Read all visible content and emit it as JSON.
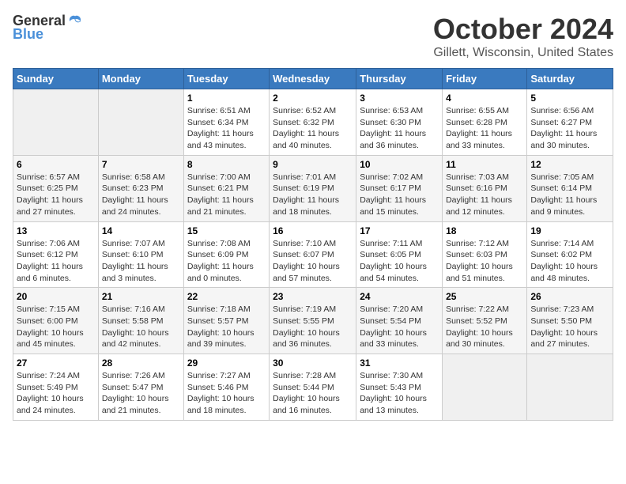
{
  "header": {
    "logo_general": "General",
    "logo_blue": "Blue",
    "title": "October 2024",
    "location": "Gillett, Wisconsin, United States"
  },
  "days_of_week": [
    "Sunday",
    "Monday",
    "Tuesday",
    "Wednesday",
    "Thursday",
    "Friday",
    "Saturday"
  ],
  "weeks": [
    [
      {
        "day": "",
        "empty": true
      },
      {
        "day": "",
        "empty": true
      },
      {
        "day": "1",
        "sunrise": "Sunrise: 6:51 AM",
        "sunset": "Sunset: 6:34 PM",
        "daylight": "Daylight: 11 hours and 43 minutes."
      },
      {
        "day": "2",
        "sunrise": "Sunrise: 6:52 AM",
        "sunset": "Sunset: 6:32 PM",
        "daylight": "Daylight: 11 hours and 40 minutes."
      },
      {
        "day": "3",
        "sunrise": "Sunrise: 6:53 AM",
        "sunset": "Sunset: 6:30 PM",
        "daylight": "Daylight: 11 hours and 36 minutes."
      },
      {
        "day": "4",
        "sunrise": "Sunrise: 6:55 AM",
        "sunset": "Sunset: 6:28 PM",
        "daylight": "Daylight: 11 hours and 33 minutes."
      },
      {
        "day": "5",
        "sunrise": "Sunrise: 6:56 AM",
        "sunset": "Sunset: 6:27 PM",
        "daylight": "Daylight: 11 hours and 30 minutes."
      }
    ],
    [
      {
        "day": "6",
        "sunrise": "Sunrise: 6:57 AM",
        "sunset": "Sunset: 6:25 PM",
        "daylight": "Daylight: 11 hours and 27 minutes."
      },
      {
        "day": "7",
        "sunrise": "Sunrise: 6:58 AM",
        "sunset": "Sunset: 6:23 PM",
        "daylight": "Daylight: 11 hours and 24 minutes."
      },
      {
        "day": "8",
        "sunrise": "Sunrise: 7:00 AM",
        "sunset": "Sunset: 6:21 PM",
        "daylight": "Daylight: 11 hours and 21 minutes."
      },
      {
        "day": "9",
        "sunrise": "Sunrise: 7:01 AM",
        "sunset": "Sunset: 6:19 PM",
        "daylight": "Daylight: 11 hours and 18 minutes."
      },
      {
        "day": "10",
        "sunrise": "Sunrise: 7:02 AM",
        "sunset": "Sunset: 6:17 PM",
        "daylight": "Daylight: 11 hours and 15 minutes."
      },
      {
        "day": "11",
        "sunrise": "Sunrise: 7:03 AM",
        "sunset": "Sunset: 6:16 PM",
        "daylight": "Daylight: 11 hours and 12 minutes."
      },
      {
        "day": "12",
        "sunrise": "Sunrise: 7:05 AM",
        "sunset": "Sunset: 6:14 PM",
        "daylight": "Daylight: 11 hours and 9 minutes."
      }
    ],
    [
      {
        "day": "13",
        "sunrise": "Sunrise: 7:06 AM",
        "sunset": "Sunset: 6:12 PM",
        "daylight": "Daylight: 11 hours and 6 minutes."
      },
      {
        "day": "14",
        "sunrise": "Sunrise: 7:07 AM",
        "sunset": "Sunset: 6:10 PM",
        "daylight": "Daylight: 11 hours and 3 minutes."
      },
      {
        "day": "15",
        "sunrise": "Sunrise: 7:08 AM",
        "sunset": "Sunset: 6:09 PM",
        "daylight": "Daylight: 11 hours and 0 minutes."
      },
      {
        "day": "16",
        "sunrise": "Sunrise: 7:10 AM",
        "sunset": "Sunset: 6:07 PM",
        "daylight": "Daylight: 10 hours and 57 minutes."
      },
      {
        "day": "17",
        "sunrise": "Sunrise: 7:11 AM",
        "sunset": "Sunset: 6:05 PM",
        "daylight": "Daylight: 10 hours and 54 minutes."
      },
      {
        "day": "18",
        "sunrise": "Sunrise: 7:12 AM",
        "sunset": "Sunset: 6:03 PM",
        "daylight": "Daylight: 10 hours and 51 minutes."
      },
      {
        "day": "19",
        "sunrise": "Sunrise: 7:14 AM",
        "sunset": "Sunset: 6:02 PM",
        "daylight": "Daylight: 10 hours and 48 minutes."
      }
    ],
    [
      {
        "day": "20",
        "sunrise": "Sunrise: 7:15 AM",
        "sunset": "Sunset: 6:00 PM",
        "daylight": "Daylight: 10 hours and 45 minutes."
      },
      {
        "day": "21",
        "sunrise": "Sunrise: 7:16 AM",
        "sunset": "Sunset: 5:58 PM",
        "daylight": "Daylight: 10 hours and 42 minutes."
      },
      {
        "day": "22",
        "sunrise": "Sunrise: 7:18 AM",
        "sunset": "Sunset: 5:57 PM",
        "daylight": "Daylight: 10 hours and 39 minutes."
      },
      {
        "day": "23",
        "sunrise": "Sunrise: 7:19 AM",
        "sunset": "Sunset: 5:55 PM",
        "daylight": "Daylight: 10 hours and 36 minutes."
      },
      {
        "day": "24",
        "sunrise": "Sunrise: 7:20 AM",
        "sunset": "Sunset: 5:54 PM",
        "daylight": "Daylight: 10 hours and 33 minutes."
      },
      {
        "day": "25",
        "sunrise": "Sunrise: 7:22 AM",
        "sunset": "Sunset: 5:52 PM",
        "daylight": "Daylight: 10 hours and 30 minutes."
      },
      {
        "day": "26",
        "sunrise": "Sunrise: 7:23 AM",
        "sunset": "Sunset: 5:50 PM",
        "daylight": "Daylight: 10 hours and 27 minutes."
      }
    ],
    [
      {
        "day": "27",
        "sunrise": "Sunrise: 7:24 AM",
        "sunset": "Sunset: 5:49 PM",
        "daylight": "Daylight: 10 hours and 24 minutes."
      },
      {
        "day": "28",
        "sunrise": "Sunrise: 7:26 AM",
        "sunset": "Sunset: 5:47 PM",
        "daylight": "Daylight: 10 hours and 21 minutes."
      },
      {
        "day": "29",
        "sunrise": "Sunrise: 7:27 AM",
        "sunset": "Sunset: 5:46 PM",
        "daylight": "Daylight: 10 hours and 18 minutes."
      },
      {
        "day": "30",
        "sunrise": "Sunrise: 7:28 AM",
        "sunset": "Sunset: 5:44 PM",
        "daylight": "Daylight: 10 hours and 16 minutes."
      },
      {
        "day": "31",
        "sunrise": "Sunrise: 7:30 AM",
        "sunset": "Sunset: 5:43 PM",
        "daylight": "Daylight: 10 hours and 13 minutes."
      },
      {
        "day": "",
        "empty": true
      },
      {
        "day": "",
        "empty": true
      }
    ]
  ]
}
